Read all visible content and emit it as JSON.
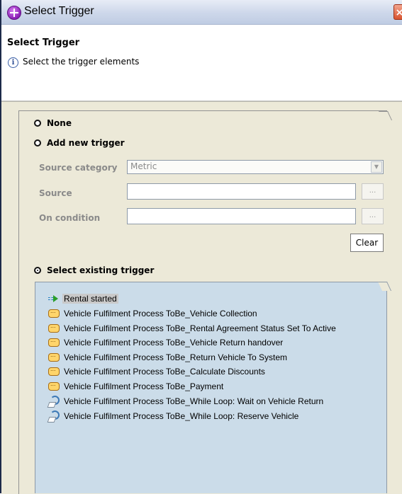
{
  "window": {
    "title": "Select Trigger",
    "close_icon": "close-icon",
    "app_icon": "app-icon"
  },
  "header": {
    "title": "Select Trigger",
    "info_icon": "info-icon",
    "info_text": "Select the trigger elements"
  },
  "options": {
    "none_label": "None",
    "add_new_label": "Add new trigger",
    "select_existing_label": "Select existing trigger",
    "selected": "Select existing trigger"
  },
  "fields": {
    "source_category_label": "Source category",
    "source_category_value": "Metric",
    "source_label": "Source",
    "source_value": "",
    "on_condition_label": "On condition",
    "on_condition_value": "",
    "browse_label": "...",
    "clear_label": "Clear"
  },
  "triggers": [
    {
      "label": "Rental started",
      "icon": "start-event-icon",
      "selected": true
    },
    {
      "label": "Vehicle Fulfilment Process ToBe_Vehicle Collection",
      "icon": "task-icon"
    },
    {
      "label": "Vehicle Fulfilment Process ToBe_Rental Agreement Status Set To Active",
      "icon": "task-icon"
    },
    {
      "label": "Vehicle Fulfilment Process ToBe_Vehicle Return handover",
      "icon": "task-icon"
    },
    {
      "label": "Vehicle Fulfilment Process ToBe_Return Vehicle To System",
      "icon": "task-icon"
    },
    {
      "label": "Vehicle Fulfilment Process ToBe_Calculate Discounts",
      "icon": "task-icon"
    },
    {
      "label": "Vehicle Fulfilment Process ToBe_Payment",
      "icon": "task-icon"
    },
    {
      "label": "Vehicle Fulfilment Process ToBe_While Loop: Wait on Vehicle Return",
      "icon": "loop-icon"
    },
    {
      "label": "Vehicle Fulfilment Process ToBe_While Loop: Reserve Vehicle",
      "icon": "loop-icon"
    }
  ]
}
